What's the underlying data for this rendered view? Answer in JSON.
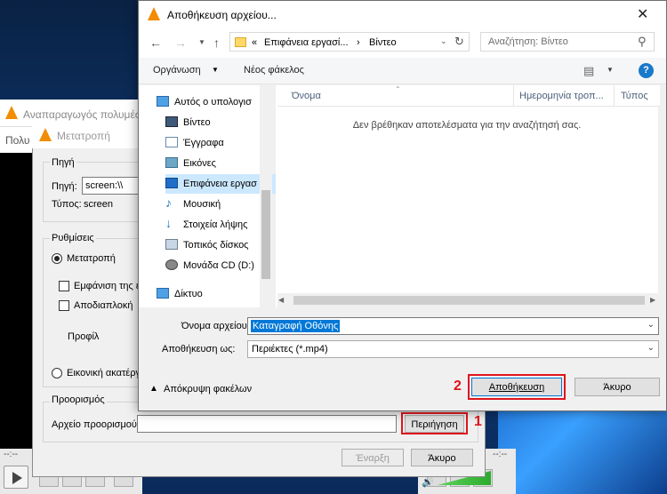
{
  "vlc": {
    "title": "Αναπαραγωγός πολυμέσ",
    "menu": "Πολυ",
    "time_left": "--:--",
    "time_right": "--:--"
  },
  "convert": {
    "title": "Μετατροπή",
    "source_group": "Πηγή",
    "source_label": "Πηγή:",
    "source_value": "screen:\\\\",
    "type_label": "Τύπος:",
    "type_value": "screen",
    "settings_group": "Ρυθμίσεις",
    "convert_radio": "Μετατροπή",
    "show_output_check": "Εμφάνιση της εξ",
    "deinterlace_check": "Αποδιαπλοκή",
    "profile_label": "Προφίλ",
    "dump_raw_radio": "Εικονική ακατέργ",
    "destination_group": "Προορισμός",
    "dest_file_label": "Αρχείο προορισμού:",
    "dest_file_value": "",
    "browse_button": "Περιήγηση",
    "start_button": "Έναρξη",
    "cancel_button": "Άκυρο"
  },
  "save_dialog": {
    "title": "Αποθήκευση αρχείου...",
    "address_prefix": "«",
    "address_part1": "Επιφάνεια εργασί...",
    "address_sep": "›",
    "address_part2": "Βίντεο",
    "search_placeholder": "Αναζήτηση: Βίντεο",
    "organize": "Οργάνωση",
    "new_folder": "Νέος φάκελος",
    "tree": [
      {
        "label": "Αυτός ο υπολογισ",
        "icon": "computer-icon"
      },
      {
        "label": "Βίντεο",
        "icon": "video-folder-icon"
      },
      {
        "label": "Έγγραφα",
        "icon": "documents-folder-icon"
      },
      {
        "label": "Εικόνες",
        "icon": "pictures-folder-icon"
      },
      {
        "label": "Επιφάνεια εργασ",
        "icon": "desktop-folder-icon"
      },
      {
        "label": "Μουσική",
        "icon": "music-folder-icon"
      },
      {
        "label": "Στοιχεία λήψης",
        "icon": "downloads-folder-icon"
      },
      {
        "label": "Τοπικός δίσκος",
        "icon": "local-disk-icon"
      },
      {
        "label": "Μονάδα CD (D:)",
        "icon": "cd-drive-icon"
      },
      {
        "label": "Δίκτυο",
        "icon": "network-icon"
      }
    ],
    "columns": [
      "Όνομα",
      "Ημερομηνία τροπ...",
      "Τύπος"
    ],
    "empty_message": "Δεν βρέθηκαν αποτελέσματα για την αναζήτησή σας.",
    "filename_label": "Όνομα αρχείου:",
    "filename_value": "Καταγραφή Οθόνης",
    "save_as_label": "Αποθήκευση ως:",
    "save_as_value": "Περιέκτες (*.mp4)",
    "hide_folders": "Απόκρυψη φακέλων",
    "save_button": "Αποθήκευση",
    "cancel_button": "Άκυρο"
  },
  "annotations": {
    "step1": "1",
    "step2": "2"
  },
  "colors": {
    "accent": "#0078d7",
    "annotation_red": "#e0141e"
  }
}
